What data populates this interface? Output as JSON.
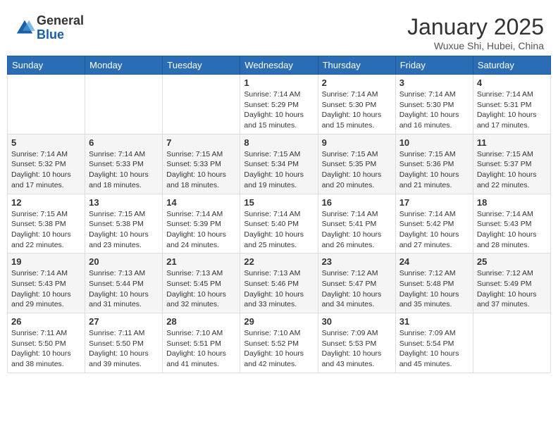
{
  "header": {
    "logo_general": "General",
    "logo_blue": "Blue",
    "month_title": "January 2025",
    "location": "Wuxue Shi, Hubei, China"
  },
  "weekdays": [
    "Sunday",
    "Monday",
    "Tuesday",
    "Wednesday",
    "Thursday",
    "Friday",
    "Saturday"
  ],
  "weeks": [
    [
      {
        "day": "",
        "info": ""
      },
      {
        "day": "",
        "info": ""
      },
      {
        "day": "",
        "info": ""
      },
      {
        "day": "1",
        "info": "Sunrise: 7:14 AM\nSunset: 5:29 PM\nDaylight: 10 hours and 15 minutes."
      },
      {
        "day": "2",
        "info": "Sunrise: 7:14 AM\nSunset: 5:30 PM\nDaylight: 10 hours and 15 minutes."
      },
      {
        "day": "3",
        "info": "Sunrise: 7:14 AM\nSunset: 5:30 PM\nDaylight: 10 hours and 16 minutes."
      },
      {
        "day": "4",
        "info": "Sunrise: 7:14 AM\nSunset: 5:31 PM\nDaylight: 10 hours and 17 minutes."
      }
    ],
    [
      {
        "day": "5",
        "info": "Sunrise: 7:14 AM\nSunset: 5:32 PM\nDaylight: 10 hours and 17 minutes."
      },
      {
        "day": "6",
        "info": "Sunrise: 7:14 AM\nSunset: 5:33 PM\nDaylight: 10 hours and 18 minutes."
      },
      {
        "day": "7",
        "info": "Sunrise: 7:15 AM\nSunset: 5:33 PM\nDaylight: 10 hours and 18 minutes."
      },
      {
        "day": "8",
        "info": "Sunrise: 7:15 AM\nSunset: 5:34 PM\nDaylight: 10 hours and 19 minutes."
      },
      {
        "day": "9",
        "info": "Sunrise: 7:15 AM\nSunset: 5:35 PM\nDaylight: 10 hours and 20 minutes."
      },
      {
        "day": "10",
        "info": "Sunrise: 7:15 AM\nSunset: 5:36 PM\nDaylight: 10 hours and 21 minutes."
      },
      {
        "day": "11",
        "info": "Sunrise: 7:15 AM\nSunset: 5:37 PM\nDaylight: 10 hours and 22 minutes."
      }
    ],
    [
      {
        "day": "12",
        "info": "Sunrise: 7:15 AM\nSunset: 5:38 PM\nDaylight: 10 hours and 22 minutes."
      },
      {
        "day": "13",
        "info": "Sunrise: 7:15 AM\nSunset: 5:38 PM\nDaylight: 10 hours and 23 minutes."
      },
      {
        "day": "14",
        "info": "Sunrise: 7:14 AM\nSunset: 5:39 PM\nDaylight: 10 hours and 24 minutes."
      },
      {
        "day": "15",
        "info": "Sunrise: 7:14 AM\nSunset: 5:40 PM\nDaylight: 10 hours and 25 minutes."
      },
      {
        "day": "16",
        "info": "Sunrise: 7:14 AM\nSunset: 5:41 PM\nDaylight: 10 hours and 26 minutes."
      },
      {
        "day": "17",
        "info": "Sunrise: 7:14 AM\nSunset: 5:42 PM\nDaylight: 10 hours and 27 minutes."
      },
      {
        "day": "18",
        "info": "Sunrise: 7:14 AM\nSunset: 5:43 PM\nDaylight: 10 hours and 28 minutes."
      }
    ],
    [
      {
        "day": "19",
        "info": "Sunrise: 7:14 AM\nSunset: 5:43 PM\nDaylight: 10 hours and 29 minutes."
      },
      {
        "day": "20",
        "info": "Sunrise: 7:13 AM\nSunset: 5:44 PM\nDaylight: 10 hours and 31 minutes."
      },
      {
        "day": "21",
        "info": "Sunrise: 7:13 AM\nSunset: 5:45 PM\nDaylight: 10 hours and 32 minutes."
      },
      {
        "day": "22",
        "info": "Sunrise: 7:13 AM\nSunset: 5:46 PM\nDaylight: 10 hours and 33 minutes."
      },
      {
        "day": "23",
        "info": "Sunrise: 7:12 AM\nSunset: 5:47 PM\nDaylight: 10 hours and 34 minutes."
      },
      {
        "day": "24",
        "info": "Sunrise: 7:12 AM\nSunset: 5:48 PM\nDaylight: 10 hours and 35 minutes."
      },
      {
        "day": "25",
        "info": "Sunrise: 7:12 AM\nSunset: 5:49 PM\nDaylight: 10 hours and 37 minutes."
      }
    ],
    [
      {
        "day": "26",
        "info": "Sunrise: 7:11 AM\nSunset: 5:50 PM\nDaylight: 10 hours and 38 minutes."
      },
      {
        "day": "27",
        "info": "Sunrise: 7:11 AM\nSunset: 5:50 PM\nDaylight: 10 hours and 39 minutes."
      },
      {
        "day": "28",
        "info": "Sunrise: 7:10 AM\nSunset: 5:51 PM\nDaylight: 10 hours and 41 minutes."
      },
      {
        "day": "29",
        "info": "Sunrise: 7:10 AM\nSunset: 5:52 PM\nDaylight: 10 hours and 42 minutes."
      },
      {
        "day": "30",
        "info": "Sunrise: 7:09 AM\nSunset: 5:53 PM\nDaylight: 10 hours and 43 minutes."
      },
      {
        "day": "31",
        "info": "Sunrise: 7:09 AM\nSunset: 5:54 PM\nDaylight: 10 hours and 45 minutes."
      },
      {
        "day": "",
        "info": ""
      }
    ]
  ]
}
